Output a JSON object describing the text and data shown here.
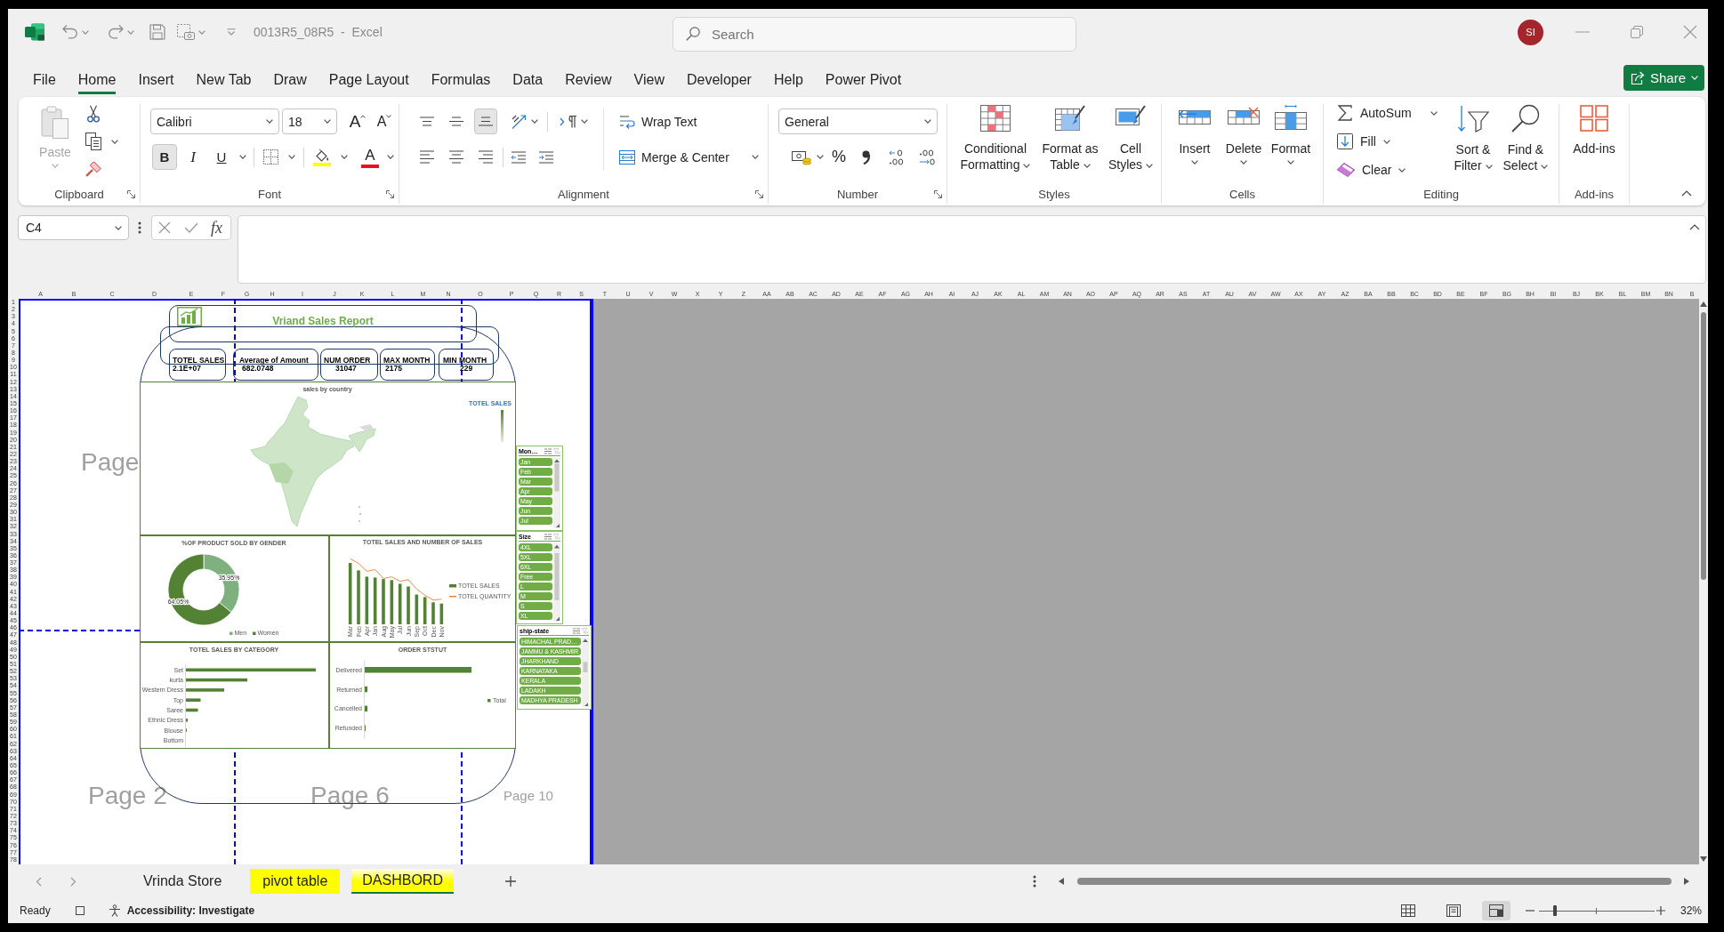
{
  "title_bar": {
    "title": "0013R5_08R5  -  Excel",
    "search": {
      "placeholder": "Search"
    },
    "account": {
      "initials": "SI"
    }
  },
  "menu_tabs": [
    {
      "label": "File",
      "selected": false
    },
    {
      "label": "Home",
      "selected": true
    },
    {
      "label": "Insert",
      "selected": false
    },
    {
      "label": "New Tab",
      "selected": false
    },
    {
      "label": "Draw",
      "selected": false
    },
    {
      "label": "Page Layout",
      "selected": false
    },
    {
      "label": "Formulas",
      "selected": false
    },
    {
      "label": "Data",
      "selected": false
    },
    {
      "label": "Review",
      "selected": false
    },
    {
      "label": "View",
      "selected": false
    },
    {
      "label": "Developer",
      "selected": false
    },
    {
      "label": "Help",
      "selected": false
    },
    {
      "label": "Power Pivot",
      "selected": false
    }
  ],
  "share_button": {
    "label": "Share"
  },
  "ribbon": {
    "clipboard": {
      "paste": {
        "label": "Paste",
        "disabled": true
      },
      "label": "Clipboard"
    },
    "font": {
      "font_name": "Calibri",
      "font_size": "18",
      "grow_font": "A",
      "shrink_font": "A",
      "styles": [
        {
          "kind": "bold",
          "glyph": "B",
          "selected": true
        },
        {
          "kind": "italic",
          "glyph": "I",
          "selected": false
        },
        {
          "kind": "underline",
          "glyph": "U",
          "selected": false
        }
      ],
      "font_color": "A",
      "label": "Font"
    },
    "alignment": {
      "vertical": [
        {
          "kind": "top",
          "selected": false
        },
        {
          "kind": "middle",
          "selected": false
        },
        {
          "kind": "bottom",
          "selected": true
        }
      ],
      "horizontal": [
        {
          "kind": "left",
          "selected": false
        },
        {
          "kind": "center",
          "selected": false
        },
        {
          "kind": "right",
          "selected": false
        }
      ],
      "wrap_text": "Wrap Text",
      "merge_center": "Merge & Center",
      "label": "Alignment"
    },
    "number": {
      "format": "General",
      "percent": "%",
      "label": "Number"
    },
    "styles": {
      "buttons": [
        {
          "kind": "conditional_formatting",
          "label": "Conditional\nFormatting"
        },
        {
          "kind": "format_as_table",
          "label": "Format as\nTable"
        },
        {
          "kind": "cell_styles",
          "label": "Cell\nStyles"
        }
      ],
      "label": "Styles"
    },
    "cells": {
      "buttons": [
        {
          "kind": "insert",
          "label": "Insert"
        },
        {
          "kind": "delete",
          "label": "Delete"
        },
        {
          "kind": "format",
          "label": "Format"
        }
      ],
      "label": "Cells"
    },
    "editing": {
      "autosum": "AutoSum",
      "fill": "Fill",
      "clear": "Clear",
      "sort_filter": "Sort &\nFilter",
      "find_select": "Find &\nSelect",
      "label": "Editing"
    },
    "add_ins": {
      "button": "Add-ins",
      "label": "Add-ins"
    }
  },
  "formula_bar": {
    "name_box": "C4",
    "function_button": "fx"
  },
  "sheet": {
    "columns": [
      "A",
      "B",
      "C",
      "D",
      "E",
      "F",
      "G",
      "H",
      "I",
      "J",
      "K",
      "L",
      "M",
      "N",
      "O",
      "P",
      "Q",
      "R",
      "S",
      "T",
      "U",
      "V",
      "W",
      "X",
      "Y",
      "Z",
      "AA",
      "AB",
      "AC",
      "AD",
      "AE",
      "AF",
      "AG",
      "AH",
      "AI",
      "AJ",
      "AK",
      "AL",
      "AM",
      "AN",
      "AO",
      "AP",
      "AQ",
      "AR",
      "AS",
      "AT",
      "AU",
      "AV",
      "AW",
      "AX",
      "AY",
      "AZ",
      "BA",
      "BB",
      "BC",
      "BD",
      "BE",
      "BF",
      "BG",
      "BH",
      "BI",
      "BJ",
      "BK",
      "BL",
      "BM",
      "BN",
      "B"
    ],
    "rows": [
      "1",
      "2",
      "3",
      "4",
      "5",
      "6",
      "7",
      "8",
      "9",
      "10",
      "11",
      "12",
      "13",
      "14",
      "15",
      "16",
      "17",
      "18",
      "19",
      "20",
      "21",
      "22",
      "23",
      "24",
      "25",
      "26",
      "27",
      "28",
      "29",
      "30",
      "31",
      "32",
      "33",
      "34",
      "35",
      "36",
      "37",
      "38",
      "39",
      "40",
      "41",
      "42",
      "43",
      "44",
      "45",
      "46",
      "47",
      "48",
      "49",
      "50",
      "51",
      "52",
      "53",
      "54",
      "55",
      "56",
      "57",
      "58",
      "59",
      "60",
      "61",
      "62",
      "63",
      "64",
      "65",
      "66",
      "67",
      "68",
      "69",
      "70",
      "71",
      "72",
      "73",
      "74",
      "75",
      "76",
      "77",
      "78"
    ],
    "page_labels": [
      "Page",
      "Page 2",
      "Page 6",
      "Page 10"
    ],
    "dashboard": {
      "title": "Vriand Sales Report",
      "kpis": [
        {
          "label": "TOTEL SALES",
          "value": "2.1E+07"
        },
        {
          "label": "Average of Amount",
          "value": "682.0748"
        },
        {
          "label": "NUM ORDER",
          "value": "31047"
        },
        {
          "label": "MAX MONTH",
          "value": "2175"
        },
        {
          "label": "MIN MONTH",
          "value": "229"
        }
      ],
      "map": {
        "title": "sales by country",
        "legend_title": "TOTEL SALES"
      },
      "gender_chart": {
        "chart_data": {
          "type": "donut",
          "title": "%OF PRODUCT SOLD BY GENDER",
          "categories": [
            "Men",
            "Women"
          ],
          "values": [
            35.95,
            64.05
          ],
          "colors": [
            "#7fb07f",
            "#548235"
          ],
          "value_labels": [
            "35.95%",
            "64.05%"
          ],
          "legend": "bottom"
        }
      },
      "sales_chart": {
        "title": "TOTEL SALES AND NUMBER OF SALES",
        "categories": [
          "Mar",
          "Feb",
          "Apr",
          "Jan",
          "Aug",
          "May",
          "Jul",
          "Jun",
          "Sep",
          "Oct",
          "Dec",
          "Nov"
        ],
        "legend": [
          {
            "name": "TOTEL SALES",
            "kind": "bar",
            "color": "#548235"
          },
          {
            "name": "TOTEL QUANTITY",
            "kind": "line",
            "color": "#ed7d31"
          }
        ]
      },
      "category_chart": {
        "title": "TOTEL SALES BY CATEGORY",
        "labels": [
          "Set",
          "kurta",
          "Western Dress",
          "Top",
          "Saree",
          "Ethnic Dress",
          "Blouse",
          "Bottom"
        ]
      },
      "status_chart": {
        "title": "ORDER STSTUT",
        "labels": [
          "Delivered",
          "Returned",
          "Cancelled",
          "Refunded"
        ],
        "legend": "Total"
      }
    },
    "slicers": [
      {
        "title": "Mon…",
        "items": [
          {
            "label": "Jan",
            "selected": true
          },
          {
            "label": "Feb",
            "selected": true
          },
          {
            "label": "Mar",
            "selected": true
          },
          {
            "label": "Apr",
            "selected": true
          },
          {
            "label": "May",
            "selected": true
          },
          {
            "label": "Jun",
            "selected": true
          },
          {
            "label": "Jul",
            "selected": true
          }
        ]
      },
      {
        "title": "Size",
        "items": [
          {
            "label": "4XL",
            "selected": true
          },
          {
            "label": "5XL",
            "selected": true
          },
          {
            "label": "6XL",
            "selected": true
          },
          {
            "label": "Free",
            "selected": true
          },
          {
            "label": "L",
            "selected": true
          },
          {
            "label": "M",
            "selected": true
          },
          {
            "label": "S",
            "selected": true
          },
          {
            "label": "XL",
            "selected": true
          }
        ]
      },
      {
        "title": "ship-state",
        "items": [
          {
            "label": "HIMACHAL PRAD…",
            "selected": true
          },
          {
            "label": "JAMMU & KASHMIR",
            "selected": true
          },
          {
            "label": "JHARKHAND",
            "selected": true
          },
          {
            "label": "KARNATAKA",
            "selected": true
          },
          {
            "label": "KERALA",
            "selected": true
          },
          {
            "label": "LADAKH",
            "selected": true
          },
          {
            "label": "MADHYA PRADESH",
            "selected": true
          }
        ]
      }
    ]
  },
  "sheet_tabs": [
    {
      "label": "Vrinda Store",
      "selected": false
    },
    {
      "label": "pivot table",
      "selected": false,
      "color": "#ffff00"
    },
    {
      "label": "DASHBORD",
      "selected": true,
      "color": "#ffff00"
    }
  ],
  "status_bar": {
    "mode": "Ready",
    "accessibility": "Accessibility: Investigate",
    "views": [
      {
        "kind": "normal",
        "selected": false
      },
      {
        "kind": "page_layout",
        "selected": false
      },
      {
        "kind": "page_break_preview",
        "selected": true
      }
    ],
    "zoom_slider": {
      "level": 0.14
    },
    "zoom": "32%"
  }
}
